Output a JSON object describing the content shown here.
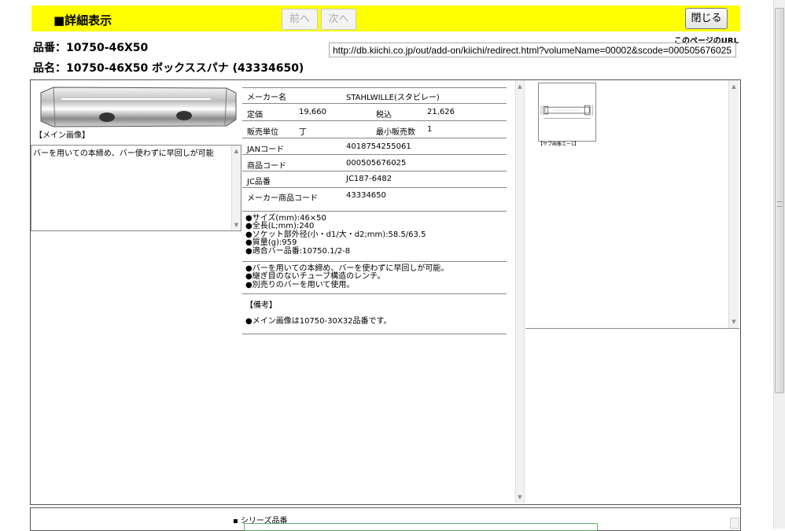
{
  "header": {
    "title": "■詳細表示",
    "prev_label": "前へ",
    "next_label": "次へ",
    "close_label": "閉じる"
  },
  "item": {
    "number_line": "品番：10750-46X50",
    "name_line": "品名：10750-46X50 ボックススパナ (43334650)",
    "url_label": "このページのURL",
    "url": "http://db.kiichi.co.jp/out/add-on/kiichi/redirect.html?volumeName=00002&scode=000505676025"
  },
  "main_image": {
    "icon": "box-spanner-image",
    "caption": "【メイン画像】"
  },
  "description": "バーを用いての本締め、バー使わずに早回しが可能",
  "spec": {
    "maker_label": "メーカー名",
    "maker_value": "STAHLWILLE(スタビレー)",
    "price_label": "定価",
    "price_value": "19,660",
    "tax_label": "税込",
    "tax_value": "21,626",
    "unit_label": "販売単位",
    "unit_value": "丁",
    "min_label": "最小販売数",
    "min_value": "1",
    "jan_label": "JANコード",
    "jan_value": "4018754255061",
    "code_label": "商品コード",
    "code_value": "000505676025",
    "jc_label": "JC品番",
    "jc_value": "JC187-6482",
    "maker_code_label": "メーカー商品コード",
    "maker_code_value": "43334650"
  },
  "specs_list": [
    "●サイズ(mm):46×50",
    "●全長(L;mm):240",
    "●ソケット部外径(小・d1/大・d2;mm):58.5/63.5",
    "●質量(g):959",
    "●適合バー品番:10750.1/2-8"
  ],
  "features_list": [
    "●バーを用いての本締め、バーを使わずに早回しが可能。",
    "●継ぎ目のないチューブ構造のレンチ。",
    "●別売りのバーを用いて使用。"
  ],
  "remarks": {
    "title": "【備考】",
    "text": "●メイン画像は10750-30X32品番です。"
  },
  "sub_image": {
    "icon": "dimension-drawing-image",
    "caption": "【サブ画像エー1】"
  },
  "series": {
    "label": "シリーズ品番"
  },
  "colors": {
    "header_bg": "#ffff00",
    "border": "#555555"
  }
}
